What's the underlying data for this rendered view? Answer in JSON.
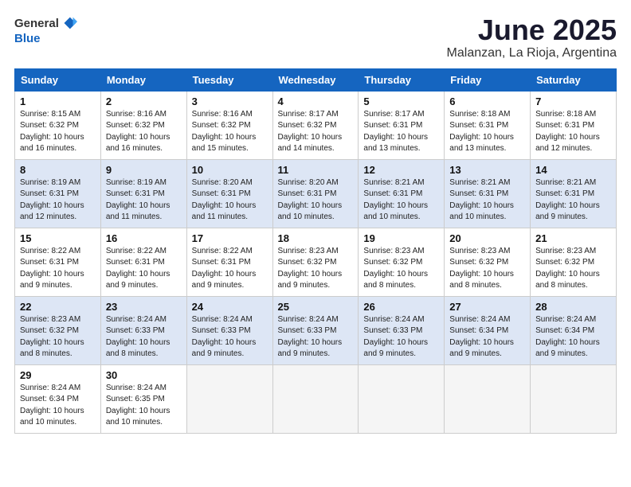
{
  "header": {
    "logo_general": "General",
    "logo_blue": "Blue",
    "month_title": "June 2025",
    "location": "Malanzan, La Rioja, Argentina"
  },
  "days_of_week": [
    "Sunday",
    "Monday",
    "Tuesday",
    "Wednesday",
    "Thursday",
    "Friday",
    "Saturday"
  ],
  "weeks": [
    [
      {
        "day": 1,
        "sunrise": "8:15 AM",
        "sunset": "6:32 PM",
        "daylight": "10 hours and 16 minutes."
      },
      {
        "day": 2,
        "sunrise": "8:16 AM",
        "sunset": "6:32 PM",
        "daylight": "10 hours and 16 minutes."
      },
      {
        "day": 3,
        "sunrise": "8:16 AM",
        "sunset": "6:32 PM",
        "daylight": "10 hours and 15 minutes."
      },
      {
        "day": 4,
        "sunrise": "8:17 AM",
        "sunset": "6:32 PM",
        "daylight": "10 hours and 14 minutes."
      },
      {
        "day": 5,
        "sunrise": "8:17 AM",
        "sunset": "6:31 PM",
        "daylight": "10 hours and 13 minutes."
      },
      {
        "day": 6,
        "sunrise": "8:18 AM",
        "sunset": "6:31 PM",
        "daylight": "10 hours and 13 minutes."
      },
      {
        "day": 7,
        "sunrise": "8:18 AM",
        "sunset": "6:31 PM",
        "daylight": "10 hours and 12 minutes."
      }
    ],
    [
      {
        "day": 8,
        "sunrise": "8:19 AM",
        "sunset": "6:31 PM",
        "daylight": "10 hours and 12 minutes."
      },
      {
        "day": 9,
        "sunrise": "8:19 AM",
        "sunset": "6:31 PM",
        "daylight": "10 hours and 11 minutes."
      },
      {
        "day": 10,
        "sunrise": "8:20 AM",
        "sunset": "6:31 PM",
        "daylight": "10 hours and 11 minutes."
      },
      {
        "day": 11,
        "sunrise": "8:20 AM",
        "sunset": "6:31 PM",
        "daylight": "10 hours and 10 minutes."
      },
      {
        "day": 12,
        "sunrise": "8:21 AM",
        "sunset": "6:31 PM",
        "daylight": "10 hours and 10 minutes."
      },
      {
        "day": 13,
        "sunrise": "8:21 AM",
        "sunset": "6:31 PM",
        "daylight": "10 hours and 10 minutes."
      },
      {
        "day": 14,
        "sunrise": "8:21 AM",
        "sunset": "6:31 PM",
        "daylight": "10 hours and 9 minutes."
      }
    ],
    [
      {
        "day": 15,
        "sunrise": "8:22 AM",
        "sunset": "6:31 PM",
        "daylight": "10 hours and 9 minutes."
      },
      {
        "day": 16,
        "sunrise": "8:22 AM",
        "sunset": "6:31 PM",
        "daylight": "10 hours and 9 minutes."
      },
      {
        "day": 17,
        "sunrise": "8:22 AM",
        "sunset": "6:31 PM",
        "daylight": "10 hours and 9 minutes."
      },
      {
        "day": 18,
        "sunrise": "8:23 AM",
        "sunset": "6:32 PM",
        "daylight": "10 hours and 9 minutes."
      },
      {
        "day": 19,
        "sunrise": "8:23 AM",
        "sunset": "6:32 PM",
        "daylight": "10 hours and 8 minutes."
      },
      {
        "day": 20,
        "sunrise": "8:23 AM",
        "sunset": "6:32 PM",
        "daylight": "10 hours and 8 minutes."
      },
      {
        "day": 21,
        "sunrise": "8:23 AM",
        "sunset": "6:32 PM",
        "daylight": "10 hours and 8 minutes."
      }
    ],
    [
      {
        "day": 22,
        "sunrise": "8:23 AM",
        "sunset": "6:32 PM",
        "daylight": "10 hours and 8 minutes."
      },
      {
        "day": 23,
        "sunrise": "8:24 AM",
        "sunset": "6:33 PM",
        "daylight": "10 hours and 8 minutes."
      },
      {
        "day": 24,
        "sunrise": "8:24 AM",
        "sunset": "6:33 PM",
        "daylight": "10 hours and 9 minutes."
      },
      {
        "day": 25,
        "sunrise": "8:24 AM",
        "sunset": "6:33 PM",
        "daylight": "10 hours and 9 minutes."
      },
      {
        "day": 26,
        "sunrise": "8:24 AM",
        "sunset": "6:33 PM",
        "daylight": "10 hours and 9 minutes."
      },
      {
        "day": 27,
        "sunrise": "8:24 AM",
        "sunset": "6:34 PM",
        "daylight": "10 hours and 9 minutes."
      },
      {
        "day": 28,
        "sunrise": "8:24 AM",
        "sunset": "6:34 PM",
        "daylight": "10 hours and 9 minutes."
      }
    ],
    [
      {
        "day": 29,
        "sunrise": "8:24 AM",
        "sunset": "6:34 PM",
        "daylight": "10 hours and 10 minutes."
      },
      {
        "day": 30,
        "sunrise": "8:24 AM",
        "sunset": "6:35 PM",
        "daylight": "10 hours and 10 minutes."
      },
      null,
      null,
      null,
      null,
      null
    ]
  ]
}
